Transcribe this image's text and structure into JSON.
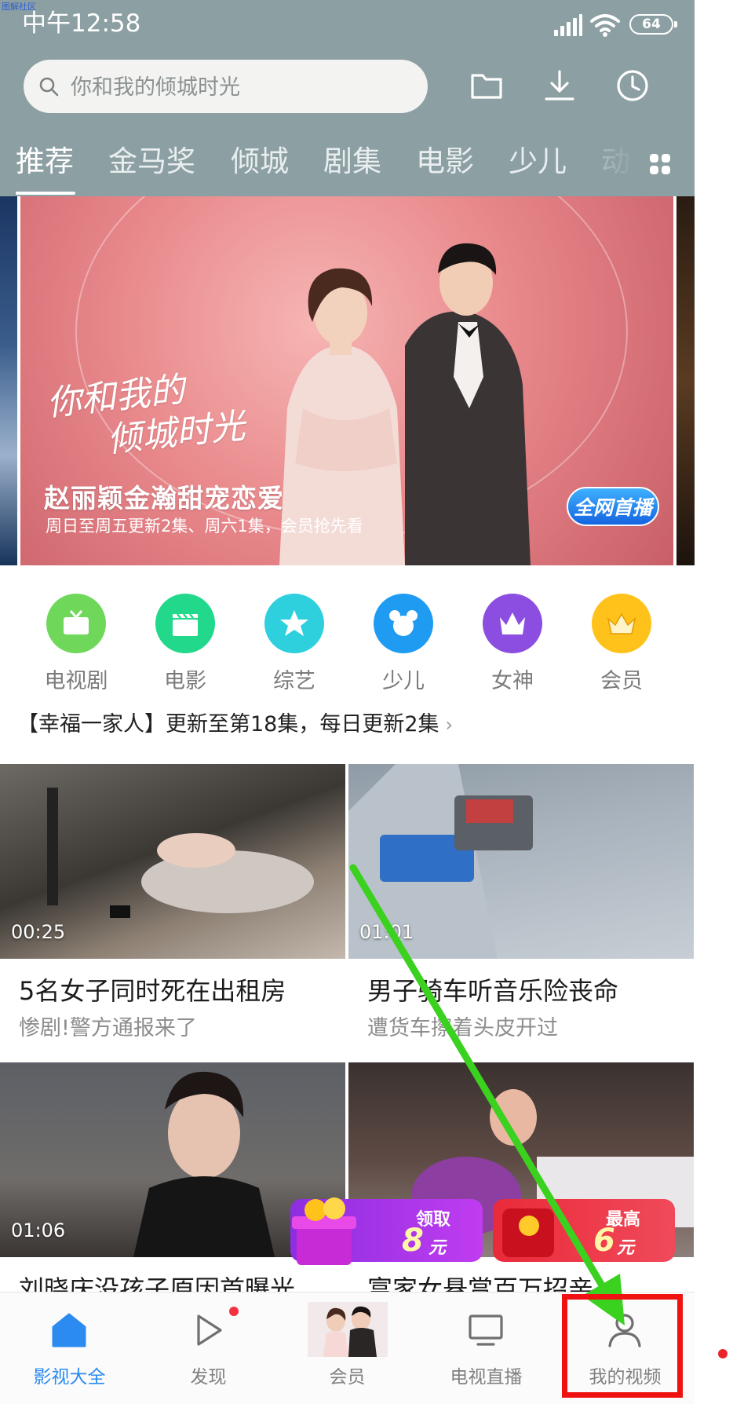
{
  "watermark": "图解社区",
  "status_bar": {
    "time": "中午12:58",
    "battery": "64"
  },
  "header": {
    "search_placeholder": "你和我的倾城时光",
    "icons": [
      "folder-icon",
      "download-icon",
      "history-icon"
    ]
  },
  "tabs": [
    "推荐",
    "金马奖",
    "倾城",
    "剧集",
    "电影",
    "少儿",
    "动"
  ],
  "banner": {
    "calligraphy_line1": "你和我的",
    "calligraphy_line2": "倾城时光",
    "title": "赵丽颖金瀚甜宠恋爱",
    "subtitle": "周日至周五更新2集、周六1集，会员抢先看",
    "badge": "全网首播"
  },
  "categories": [
    {
      "label": "电视剧",
      "color": "#6fd85a",
      "icon": "tv-icon"
    },
    {
      "label": "电影",
      "color": "#22d88b",
      "icon": "clapper-icon"
    },
    {
      "label": "综艺",
      "color": "#2ed0de",
      "icon": "star-icon"
    },
    {
      "label": "少儿",
      "color": "#1f9bf2",
      "icon": "mouse-icon"
    },
    {
      "label": "女神",
      "color": "#8b4ee0",
      "icon": "crown-icon"
    },
    {
      "label": "会员",
      "color": "#ffc21a",
      "icon": "vip-crown-icon"
    }
  ],
  "notice": "【幸福一家人】更新至第18集，每日更新2集",
  "videos": [
    {
      "duration": "00:25",
      "title": "5名女子同时死在出租房",
      "subtitle": "惨剧!警方通报来了"
    },
    {
      "duration": "01:01",
      "title": "男子骑车听音乐险丧命",
      "subtitle": "遭货车擦着头皮开过"
    },
    {
      "duration": "01:06",
      "title": "刘晓庆没孩子原因首曝光",
      "subtitle": ""
    },
    {
      "duration": "",
      "title": "富家女悬赏百万招亲",
      "subtitle": ""
    }
  ],
  "promos": {
    "left": {
      "line1": "领取",
      "amount": "8",
      "unit": "元"
    },
    "right": {
      "line1": "最高",
      "amount": "6",
      "unit": "元"
    }
  },
  "bottom_nav": [
    {
      "label": "影视大全",
      "active": true
    },
    {
      "label": "发现",
      "active": false
    },
    {
      "label": "会员",
      "active": false
    },
    {
      "label": "电视直播",
      "active": false
    },
    {
      "label": "我的视频",
      "active": false
    }
  ],
  "colors": {
    "header_bg": "#8c9fa2",
    "nav_active": "#2b8bf0",
    "highlight": "#f01111",
    "annotation_arrow": "#3ad11f"
  }
}
